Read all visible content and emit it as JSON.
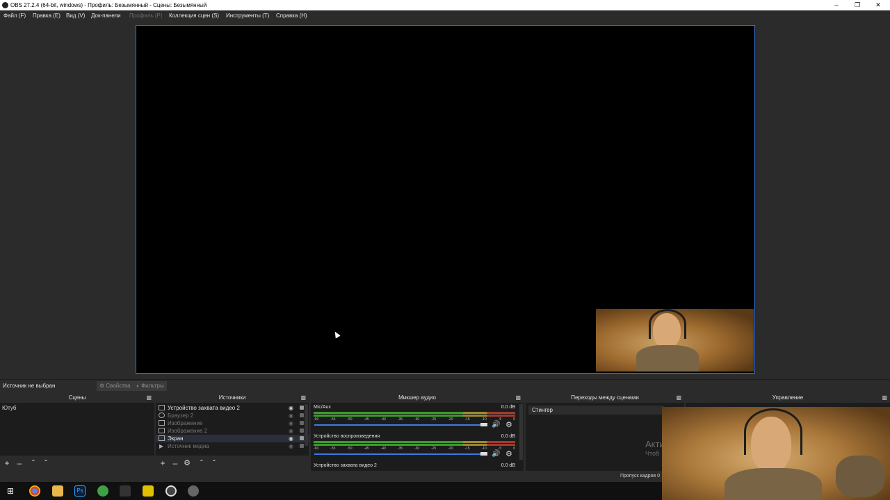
{
  "window": {
    "title": "OBS 27.2.4 (64-bit, windows) - Профиль: Безымянный - Сцены: Безымянный",
    "min_icon": "minimize-icon",
    "max_icon": "restore-icon",
    "close_icon": "close-icon"
  },
  "menu": [
    {
      "label": "Файл (F)",
      "enabled": true
    },
    {
      "label": "Правка (E)",
      "enabled": true
    },
    {
      "label": "Вид (V)",
      "enabled": true
    },
    {
      "label": "Док-панели",
      "enabled": true
    },
    {
      "label": "Профиль (P)",
      "enabled": false
    },
    {
      "label": "Коллекция сцен (S)",
      "enabled": true
    },
    {
      "label": "Инструменты (T)",
      "enabled": true
    },
    {
      "label": "Справка (H)",
      "enabled": true
    }
  ],
  "context_bar": {
    "status": "Источник не выбран",
    "properties_label": "Свойства",
    "filters_label": "Фильтры"
  },
  "docks": {
    "scenes": {
      "title": "Сцены",
      "items": [
        "Ютуб"
      ]
    },
    "sources": {
      "title": "Источники",
      "items": [
        {
          "label": "Устройство захвата видео 2",
          "visible": true,
          "icon": "camera-icon"
        },
        {
          "label": "Браузер 2",
          "visible": false,
          "icon": "browser-icon"
        },
        {
          "label": "Изображение",
          "visible": false,
          "icon": "image-icon"
        },
        {
          "label": "Изображение 2",
          "visible": false,
          "icon": "image-icon"
        },
        {
          "label": "Экран",
          "visible": true,
          "icon": "monitor-icon"
        },
        {
          "label": "Источник медиа",
          "visible": false,
          "icon": "play-icon"
        }
      ]
    },
    "mixer": {
      "title": "Микшер аудио",
      "channels": [
        {
          "name": "Mic/Aux",
          "db": "0.0 dB"
        },
        {
          "name": "Устройство воспроизведения",
          "db": "0.0 dB"
        },
        {
          "name": "Устройство захвата видео 2",
          "db": "0.0 dB"
        }
      ],
      "ticks": [
        "-60",
        "-55",
        "-50",
        "-45",
        "-40",
        "-35",
        "-30",
        "-25",
        "-20",
        "-15",
        "-10",
        "-5",
        "0"
      ]
    },
    "transitions": {
      "title": "Переходы между сценами",
      "selected": "Стингер"
    },
    "controls": {
      "title": "Управление",
      "partial_text_1": "Акти",
      "partial_text_2": "Чтоб"
    }
  },
  "status_bar": {
    "dropped_frames": "Пропуск кадров 0"
  },
  "colors": {
    "accent": "#3b74d6",
    "meter_green": "#3c9a2c",
    "meter_red": "#a33a2c"
  }
}
